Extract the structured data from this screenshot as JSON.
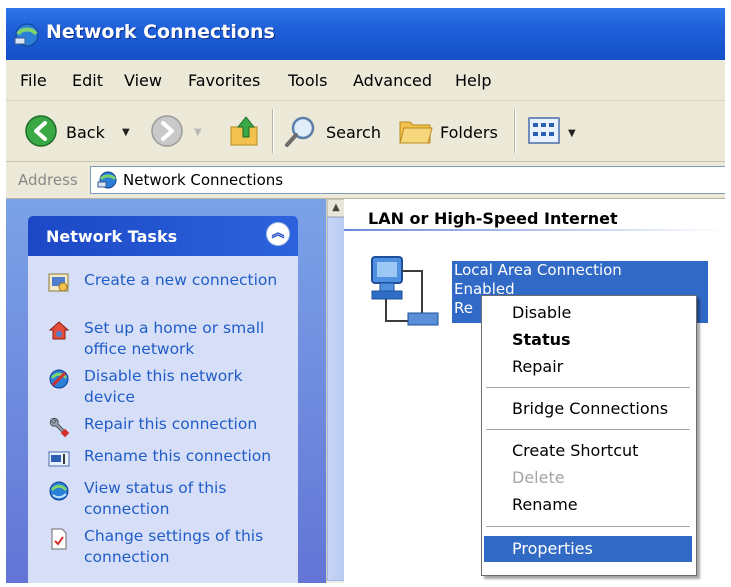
{
  "window": {
    "title": "Network Connections"
  },
  "menubar": {
    "items": [
      "File",
      "Edit",
      "View",
      "Favorites",
      "Tools",
      "Advanced",
      "Help"
    ]
  },
  "toolbar": {
    "back_label": "Back",
    "search_label": "Search",
    "folders_label": "Folders"
  },
  "address": {
    "label": "Address",
    "value": "Network Connections"
  },
  "tasks": {
    "title": "Network Tasks",
    "items": [
      "Create a new connection",
      "Set up a home or small office network",
      "Disable this network device",
      "Repair this connection",
      "Rename this connection",
      "View status of this connection",
      "Change settings of this connection"
    ]
  },
  "content": {
    "group_title": "LAN or High-Speed Internet",
    "connection": {
      "name": "Local Area Connection",
      "status": "Enabled",
      "extra": "Re"
    }
  },
  "context_menu": {
    "items": [
      {
        "label": "Disable",
        "style": "normal"
      },
      {
        "label": "Status",
        "style": "bold"
      },
      {
        "label": "Repair",
        "style": "normal"
      },
      {
        "label": "Bridge Connections",
        "style": "normal"
      },
      {
        "label": "Create Shortcut",
        "style": "normal"
      },
      {
        "label": "Delete",
        "style": "disabled"
      },
      {
        "label": "Rename",
        "style": "normal"
      },
      {
        "label": "Properties",
        "style": "selected"
      }
    ]
  },
  "colors": {
    "title_bar": "#1e5fd8",
    "task_pane": "#6f8ae0",
    "task_link": "#215dc6",
    "selection": "#316ac5"
  }
}
